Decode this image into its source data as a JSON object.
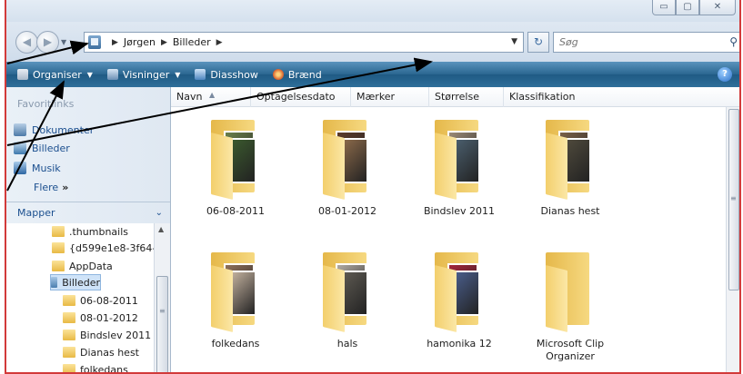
{
  "window": {
    "caption_buttons": [
      "minimize",
      "maximize",
      "close"
    ]
  },
  "nav": {
    "back_icon": "back-arrow-icon",
    "forward_icon": "forward-arrow-icon"
  },
  "address": {
    "crumbs": [
      "Jørgen",
      "Billeder"
    ]
  },
  "search": {
    "placeholder": "Søg"
  },
  "toolbar": {
    "organise": "Organiser",
    "views": "Visninger",
    "slideshow": "Diasshow",
    "burn": "Brænd"
  },
  "favorites": {
    "title": "Favoritlinks",
    "items": [
      "Dokumenter",
      "Billeder",
      "Musik"
    ],
    "more": "Flere",
    "more_glyph": "»"
  },
  "folders_pane": {
    "title": "Mapper",
    "tree": [
      ".thumbnails",
      "{d599e1e8-3f64-",
      "AppData",
      "Billeder",
      "06-08-2011",
      "08-01-2012",
      "Bindslev 2011",
      "Dianas hest",
      "folkedans"
    ],
    "selected": "Billeder"
  },
  "columns": [
    "Navn",
    "Optagelsesdato",
    "Mærker",
    "Størrelse",
    "Klassifikation"
  ],
  "folders": [
    {
      "name": "06-08-2011",
      "photo_colors": [
        "#6a7f4c",
        "#3b5a2e"
      ]
    },
    {
      "name": "08-01-2012",
      "photo_colors": [
        "#5b3a2a",
        "#8c6a4a"
      ]
    },
    {
      "name": "Bindslev 2011",
      "photo_colors": [
        "#9b8a76",
        "#4b5f6e"
      ]
    },
    {
      "name": "Dianas hest",
      "photo_colors": [
        "#7a6048",
        "#4f4a3c"
      ]
    },
    {
      "name": "folkedans",
      "photo_colors": [
        "#8d6f5a",
        "#c5b3a0"
      ]
    },
    {
      "name": "hals",
      "photo_colors": [
        "#b0aaa2",
        "#5e5a52"
      ]
    },
    {
      "name": "hamonika 12",
      "photo_colors": [
        "#a3243a",
        "#4a5e8c"
      ]
    },
    {
      "name": "Microsoft Clip Organizer",
      "photo_colors": []
    }
  ],
  "colors": {
    "toolbar": "#2a6690",
    "link": "#1b4f8f",
    "frame_border": "#d23a3a",
    "annotation_arrow": "#000000"
  }
}
